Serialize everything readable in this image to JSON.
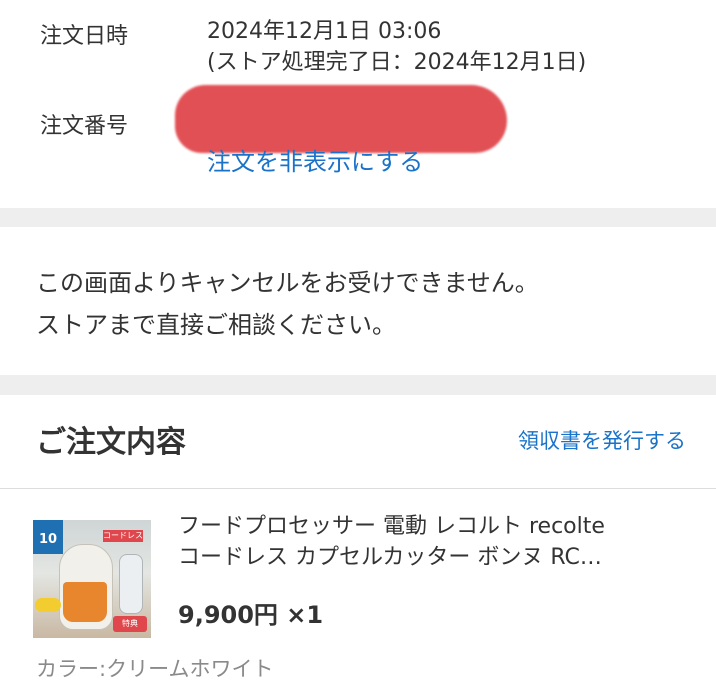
{
  "order": {
    "date_label": "注文日時",
    "date_value": "2024年12月1日 03:06",
    "date_sub": "(ストア処理完了日：2024年12月1日)",
    "number_label": "注文番号",
    "hide_link": "注文を非表示にする"
  },
  "notice": {
    "line1": "この画面よりキャンセルをお受けできません。",
    "line2": "ストアまで直接ご相談ください。"
  },
  "contents": {
    "title": "ご注文内容",
    "receipt_link": "領収書を発行する"
  },
  "product": {
    "name_line1": "フードプロセッサー 電動 レコルト recolte",
    "name_line2": "コードレス カプセルカッター ボンヌ RC…",
    "price": "9,900円 ×1",
    "color": "カラー:クリームホワイト",
    "thumb_badge": "10",
    "thumb_tag": "コードレス",
    "thumb_recipe": "特典"
  },
  "colors": {
    "link": "#1a73c9",
    "gap": "#eeeeee",
    "redaction": "#e0474c"
  }
}
